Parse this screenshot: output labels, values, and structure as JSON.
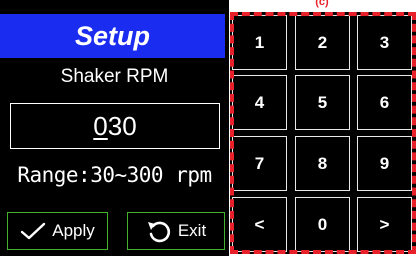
{
  "header": {
    "title": "Setup"
  },
  "parameter": {
    "label": "Shaker RPM",
    "value_prefix": "0",
    "value_rest": "30",
    "range_text": "Range:30~300 rpm"
  },
  "buttons": {
    "apply_label": "Apply",
    "exit_label": "Exit"
  },
  "keypad": {
    "tag": "(c)",
    "keys": [
      "1",
      "2",
      "3",
      "4",
      "5",
      "6",
      "7",
      "8",
      "9",
      "<",
      "0",
      ">"
    ]
  },
  "colors": {
    "title_bar": "#1a2cf0",
    "button_border": "#43b12b",
    "highlight_dash": "#e8202a"
  }
}
